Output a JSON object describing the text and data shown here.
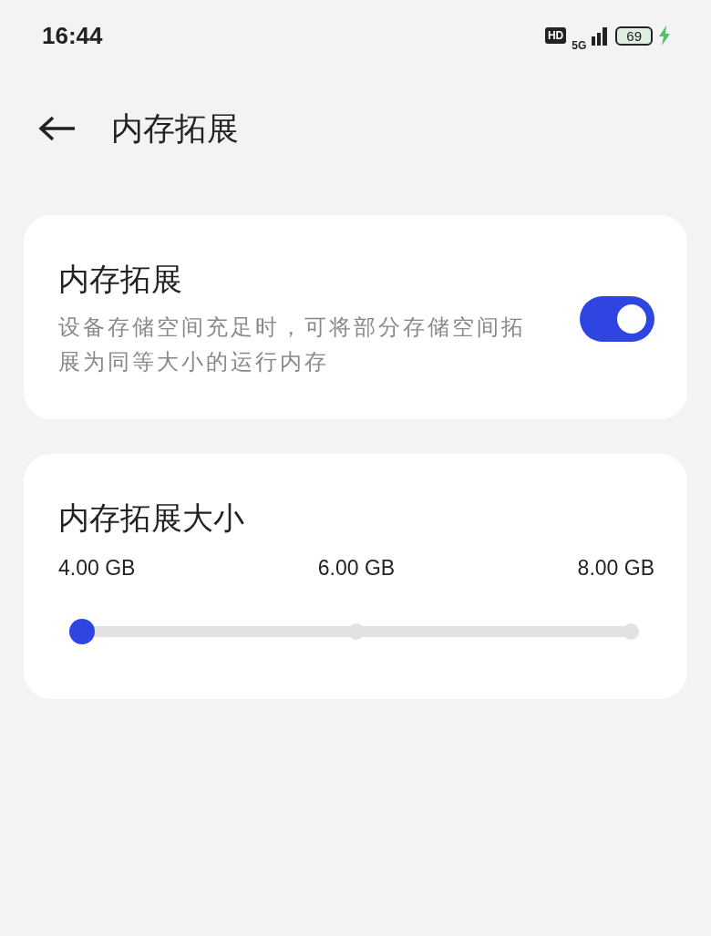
{
  "status_bar": {
    "time": "16:44",
    "hd": "HD",
    "network": "5G",
    "battery": "69",
    "charging": true
  },
  "header": {
    "title": "内存拓展"
  },
  "toggle_card": {
    "title": "内存拓展",
    "description": "设备存储空间充足时，可将部分存储空间拓展为同等大小的运行内存",
    "on": true
  },
  "size_card": {
    "title": "内存拓展大小",
    "stops": [
      "4.00 GB",
      "6.00 GB",
      "8.00 GB"
    ],
    "level": 0
  }
}
